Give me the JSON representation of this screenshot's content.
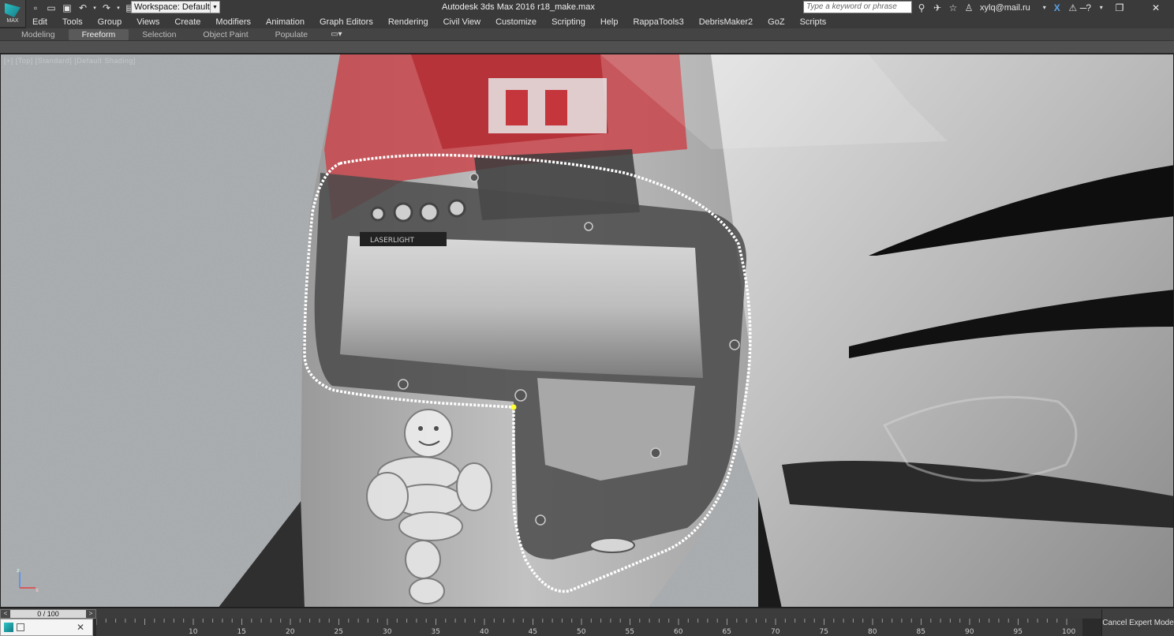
{
  "app": {
    "logo_label": "MAX",
    "window_title": "Autodesk 3ds Max 2016    r18_make.max"
  },
  "quick_access": {
    "workspace_label": "Workspace: Default"
  },
  "search": {
    "placeholder": "Type a keyword or phrase"
  },
  "user": {
    "name": "xylq@mail.ru"
  },
  "menu": {
    "items": [
      {
        "label": "Edit"
      },
      {
        "label": "Tools"
      },
      {
        "label": "Group"
      },
      {
        "label": "Views"
      },
      {
        "label": "Create"
      },
      {
        "label": "Modifiers"
      },
      {
        "label": "Animation"
      },
      {
        "label": "Graph Editors"
      },
      {
        "label": "Rendering"
      },
      {
        "label": "Civil View"
      },
      {
        "label": "Customize"
      },
      {
        "label": "Scripting"
      },
      {
        "label": "Help"
      },
      {
        "label": "RappaTools3"
      },
      {
        "label": "DebrisMaker2"
      },
      {
        "label": "GoZ"
      },
      {
        "label": "Scripts"
      }
    ]
  },
  "ribbon": {
    "tabs": [
      {
        "label": "Modeling"
      },
      {
        "label": "Freeform",
        "active": true
      },
      {
        "label": "Selection"
      },
      {
        "label": "Object Paint"
      },
      {
        "label": "Populate"
      }
    ]
  },
  "viewport": {
    "label": "[+] [Top] [Standard] [Default Shading]",
    "tripod_axes": [
      "z",
      "x"
    ]
  },
  "timeline": {
    "slider_value": "0 / 100",
    "prev_label": "<",
    "next_label": ">",
    "ticks": [
      "10",
      "15",
      "20",
      "25",
      "30",
      "35",
      "40",
      "45",
      "50",
      "55",
      "60",
      "65",
      "70",
      "75",
      "80",
      "85",
      "90",
      "95",
      "100"
    ]
  },
  "status": {
    "expert_mode_button": "Cancel Expert Mode"
  },
  "colors": {
    "ui_dark": "#3a3a3a",
    "spline_white": "#ffffff",
    "car_red": "#d2232a",
    "car_silver": "#c8c8c8"
  }
}
